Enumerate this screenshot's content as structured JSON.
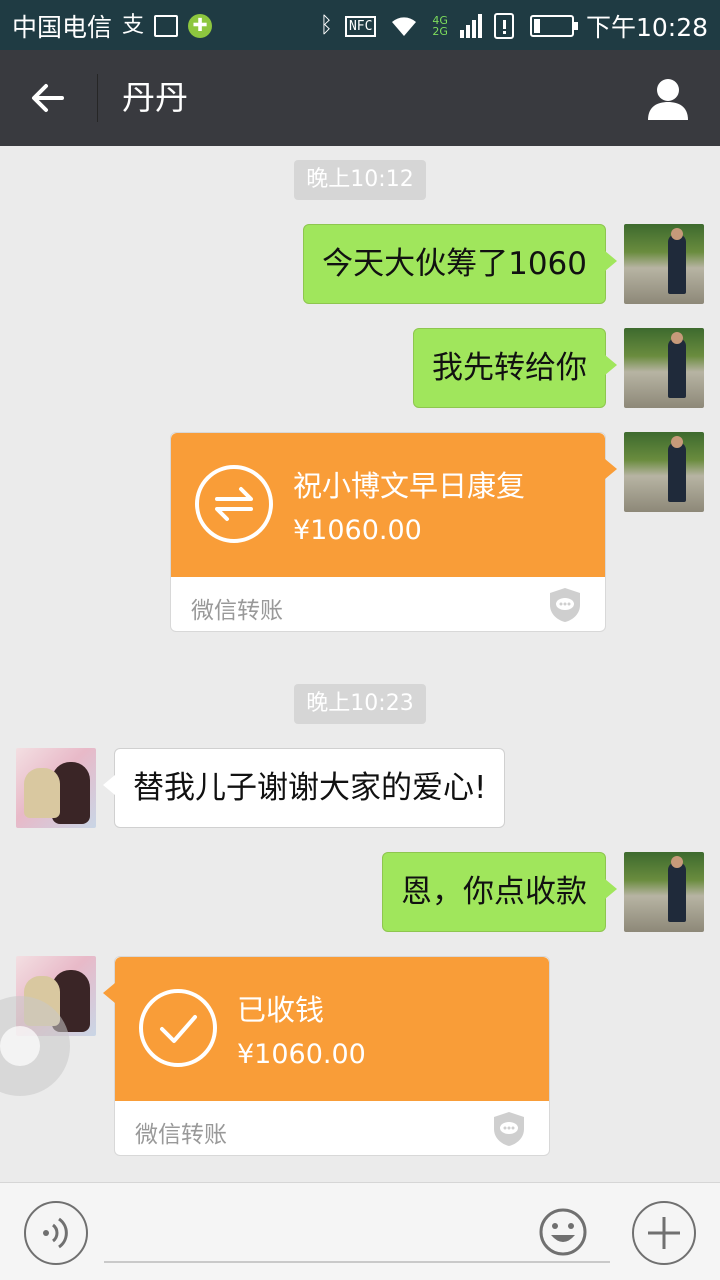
{
  "status_bar": {
    "carrier": "中国电信",
    "app_icon_text": "支",
    "nfc": "NFC",
    "net_4g": "4G",
    "net_2g": "2G",
    "time": "下午10:28"
  },
  "header": {
    "title": "丹丹"
  },
  "timestamps": [
    "晚上10:12",
    "晚上10:23"
  ],
  "messages": {
    "m1": "今天大伙筹了1060",
    "m2": "我先转给你",
    "m4": "替我儿子谢谢大家的爱心!",
    "m5": "恩，你点收款"
  },
  "transfers": {
    "sent": {
      "title": "祝小博文早日康复",
      "amount": "¥1060.00",
      "label": "微信转账"
    },
    "received": {
      "title": "已收钱",
      "amount": "¥1060.00",
      "label": "微信转账"
    }
  },
  "input": {
    "placeholder": ""
  },
  "colors": {
    "status_bar_bg": "#1f3b43",
    "nav_bg": "#393a3f",
    "chat_bg": "#ebebeb",
    "my_bubble": "#a0e65c",
    "transfer_orange": "#f99d38"
  },
  "icons": {
    "back": "arrow-left-icon",
    "profile": "person-icon",
    "transfer": "swap-arrows-icon",
    "received": "checkmark-icon",
    "shield": "shield-chat-icon",
    "voice": "voice-wave-icon",
    "emoji": "smiley-icon",
    "more": "plus-icon"
  }
}
